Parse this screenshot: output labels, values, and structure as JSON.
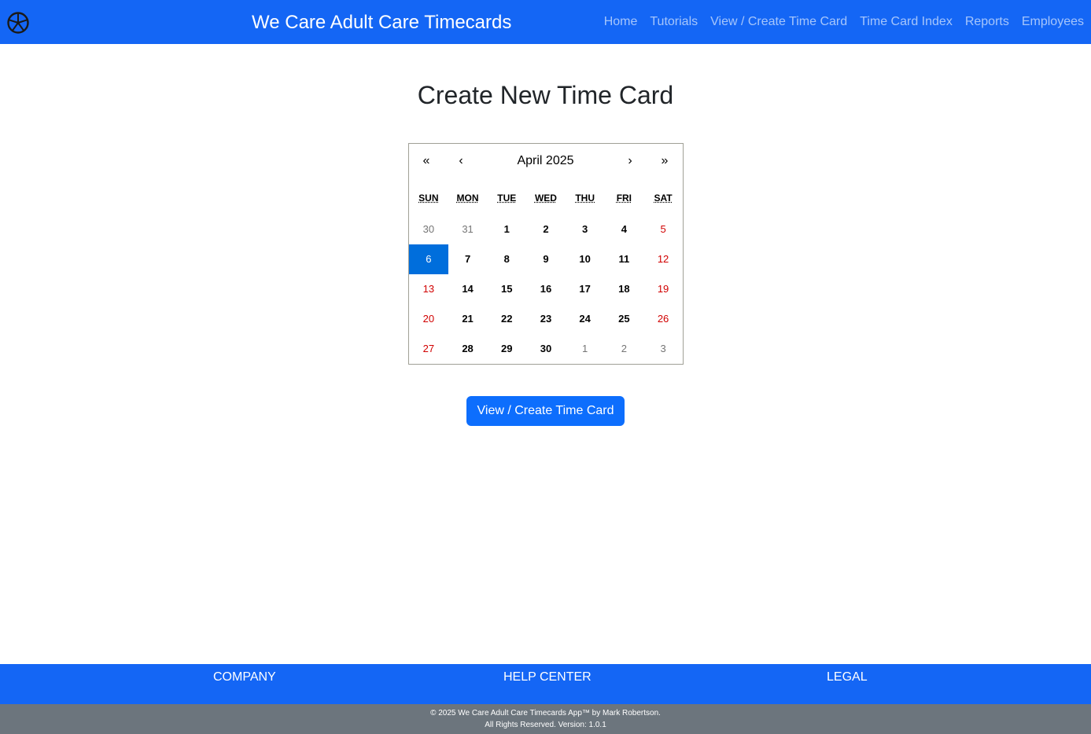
{
  "header": {
    "brand": "We Care Adult Care Timecards",
    "logo_icon": "steering-wheel-icon",
    "nav": [
      {
        "label": "Home"
      },
      {
        "label": "Tutorials"
      },
      {
        "label": "View / Create Time Card"
      },
      {
        "label": "Time Card Index"
      },
      {
        "label": "Reports"
      },
      {
        "label": "Employees"
      }
    ]
  },
  "main": {
    "title": "Create New Time Card",
    "calendar": {
      "prev_year": "«",
      "prev_month": "‹",
      "label": "April 2025",
      "next_month": "›",
      "next_year": "»",
      "weekdays": [
        "SUN",
        "MON",
        "TUE",
        "WED",
        "THU",
        "FRI",
        "SAT"
      ],
      "selected_day": "6",
      "days": [
        {
          "d": "30",
          "type": "neighbor"
        },
        {
          "d": "31",
          "type": "neighbor"
        },
        {
          "d": "1",
          "type": "weekday"
        },
        {
          "d": "2",
          "type": "weekday"
        },
        {
          "d": "3",
          "type": "weekday"
        },
        {
          "d": "4",
          "type": "weekday"
        },
        {
          "d": "5",
          "type": "weekend"
        },
        {
          "d": "6",
          "type": "active"
        },
        {
          "d": "7",
          "type": "weekday"
        },
        {
          "d": "8",
          "type": "weekday"
        },
        {
          "d": "9",
          "type": "weekday"
        },
        {
          "d": "10",
          "type": "weekday"
        },
        {
          "d": "11",
          "type": "weekday"
        },
        {
          "d": "12",
          "type": "weekend"
        },
        {
          "d": "13",
          "type": "weekend"
        },
        {
          "d": "14",
          "type": "weekday"
        },
        {
          "d": "15",
          "type": "weekday"
        },
        {
          "d": "16",
          "type": "weekday"
        },
        {
          "d": "17",
          "type": "weekday"
        },
        {
          "d": "18",
          "type": "weekday"
        },
        {
          "d": "19",
          "type": "weekend"
        },
        {
          "d": "20",
          "type": "weekend"
        },
        {
          "d": "21",
          "type": "weekday"
        },
        {
          "d": "22",
          "type": "weekday"
        },
        {
          "d": "23",
          "type": "weekday"
        },
        {
          "d": "24",
          "type": "weekday"
        },
        {
          "d": "25",
          "type": "weekday"
        },
        {
          "d": "26",
          "type": "weekend"
        },
        {
          "d": "27",
          "type": "weekend"
        },
        {
          "d": "28",
          "type": "weekday"
        },
        {
          "d": "29",
          "type": "weekday"
        },
        {
          "d": "30",
          "type": "weekday"
        },
        {
          "d": "1",
          "type": "neighbor"
        },
        {
          "d": "2",
          "type": "neighbor"
        },
        {
          "d": "3",
          "type": "neighbor"
        }
      ]
    },
    "button_label": "View / Create Time Card"
  },
  "footer": {
    "columns": [
      "COMPANY",
      "HELP CENTER",
      "LEGAL"
    ],
    "copyright_line1": "© 2025 We Care Adult Care Timecards App™ by Mark Robertson.",
    "copyright_line2": "All Rights Reserved. Version: 1.0.1"
  },
  "colors": {
    "primary": "#1466f5",
    "button": "#0d6efd",
    "selected_day": "#006edc",
    "weekend": "#d10000",
    "neighbor_day": "#757575",
    "footer_bottom": "#6c757d"
  }
}
